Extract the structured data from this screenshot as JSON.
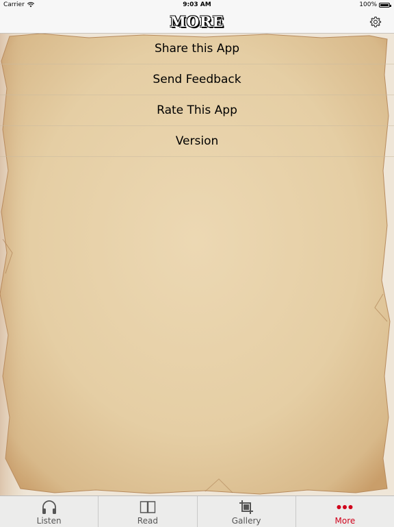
{
  "status_bar": {
    "carrier": "Carrier",
    "time": "9:03 AM",
    "battery": "100%"
  },
  "nav": {
    "title": "MORE"
  },
  "menu": {
    "items": [
      {
        "label": "Share this App"
      },
      {
        "label": "Send Feedback"
      },
      {
        "label": "Rate This App"
      },
      {
        "label": "Version"
      }
    ]
  },
  "tabs": [
    {
      "label": "Listen",
      "icon": "headphones-icon"
    },
    {
      "label": "Read",
      "icon": "book-icon"
    },
    {
      "label": "Gallery",
      "icon": "crop-icon"
    },
    {
      "label": "More",
      "icon": "more-dots-icon",
      "active": true
    }
  ],
  "colors": {
    "accent": "#d0021b",
    "parchment": "#e9d4af",
    "bar": "#f7f7f7"
  }
}
